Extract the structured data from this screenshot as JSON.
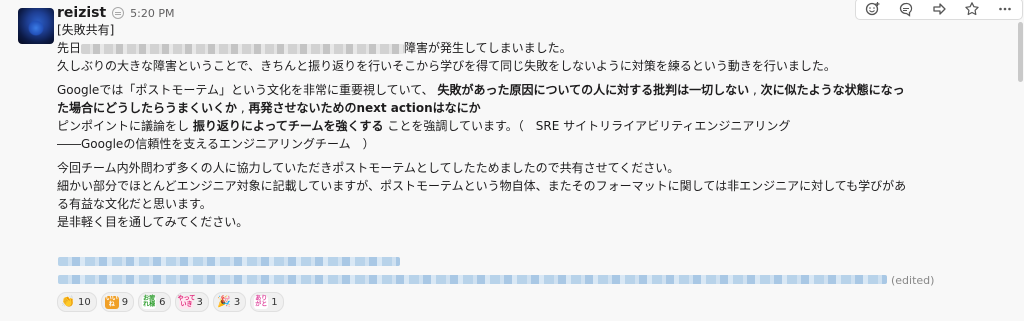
{
  "user": {
    "name": "reizist",
    "time": "5:20 PM"
  },
  "toolbar": [
    "add-reaction-icon",
    "reply-thread-icon",
    "share-message-icon",
    "save-star-icon",
    "more-actions-icon"
  ],
  "body": {
    "p1": {
      "l1": "[失敗共有]",
      "l2_pre": "先日",
      "l2_post": "障害が発生してしまいました。",
      "l3": "久しぶりの大きな障害ということで、きちんと振り返りを行いそこから学びを得て同じ失敗をしないように対策を練るという動きを行いました。"
    },
    "p2": {
      "l1_a": "Googleでは「ポストモーテム」という文化を非常に重要視していて、 ",
      "l1_b": "失敗があった原因についての人に対する批判は一切しない",
      "l1_c": " , ",
      "l1_d": "次に似たような状態になっ",
      "l2_a": "た場合にどうしたらうまくいくか",
      "l2_b": " , ",
      "l2_c": "再発させないためのnext actionはなにか",
      "l3_a": "ピンポイントに議論をし ",
      "l3_b": "振り返りによってチームを強くする",
      "l3_c": " ことを強調しています。（　SRE サイトリライアビリティエンジニアリング",
      "l4": "――Googleの信頼性を支えるエンジニアリングチーム　）"
    },
    "p3": {
      "l1": "今回チーム内外問わず多くの人に協力していただきポストモーテムとしてしたためましたので共有させてください。",
      "l2": "細かい部分でほとんどエンジニア対象に記載していますが、ポストモーテムという物自体、またそのフォーマットに関しては非エンジニアに対しても学びがあ",
      "l3": "る有益な文化だと思います。",
      "l4": "是非軽く目を通してみてください。"
    },
    "edited": "(edited)"
  },
  "reactions": [
    {
      "icon": "clap-emoji-icon",
      "emoji": "👏",
      "count": "10"
    },
    {
      "icon": "ii-ne-emoji-icon",
      "label": "いい\nね",
      "count": "9",
      "color": "#f0a028",
      "text_color": "#ffffff"
    },
    {
      "icon": "otsukare-emoji-icon",
      "label": "お疲\nれ様",
      "count": "6",
      "color": "#ffffff",
      "text_color": "#2e9e2e"
    },
    {
      "icon": "yatteiki-emoji-icon",
      "label": "やって\nいき",
      "count": "3",
      "color": "#ffe6f0",
      "text_color": "#e0287a"
    },
    {
      "icon": "tada-emoji-icon",
      "emoji": "🎉",
      "count": "3"
    },
    {
      "icon": "arigato-emoji-icon",
      "label": "あり\nがと",
      "count": "1",
      "color": "#ffffff",
      "text_color": "#e04aa0"
    }
  ]
}
